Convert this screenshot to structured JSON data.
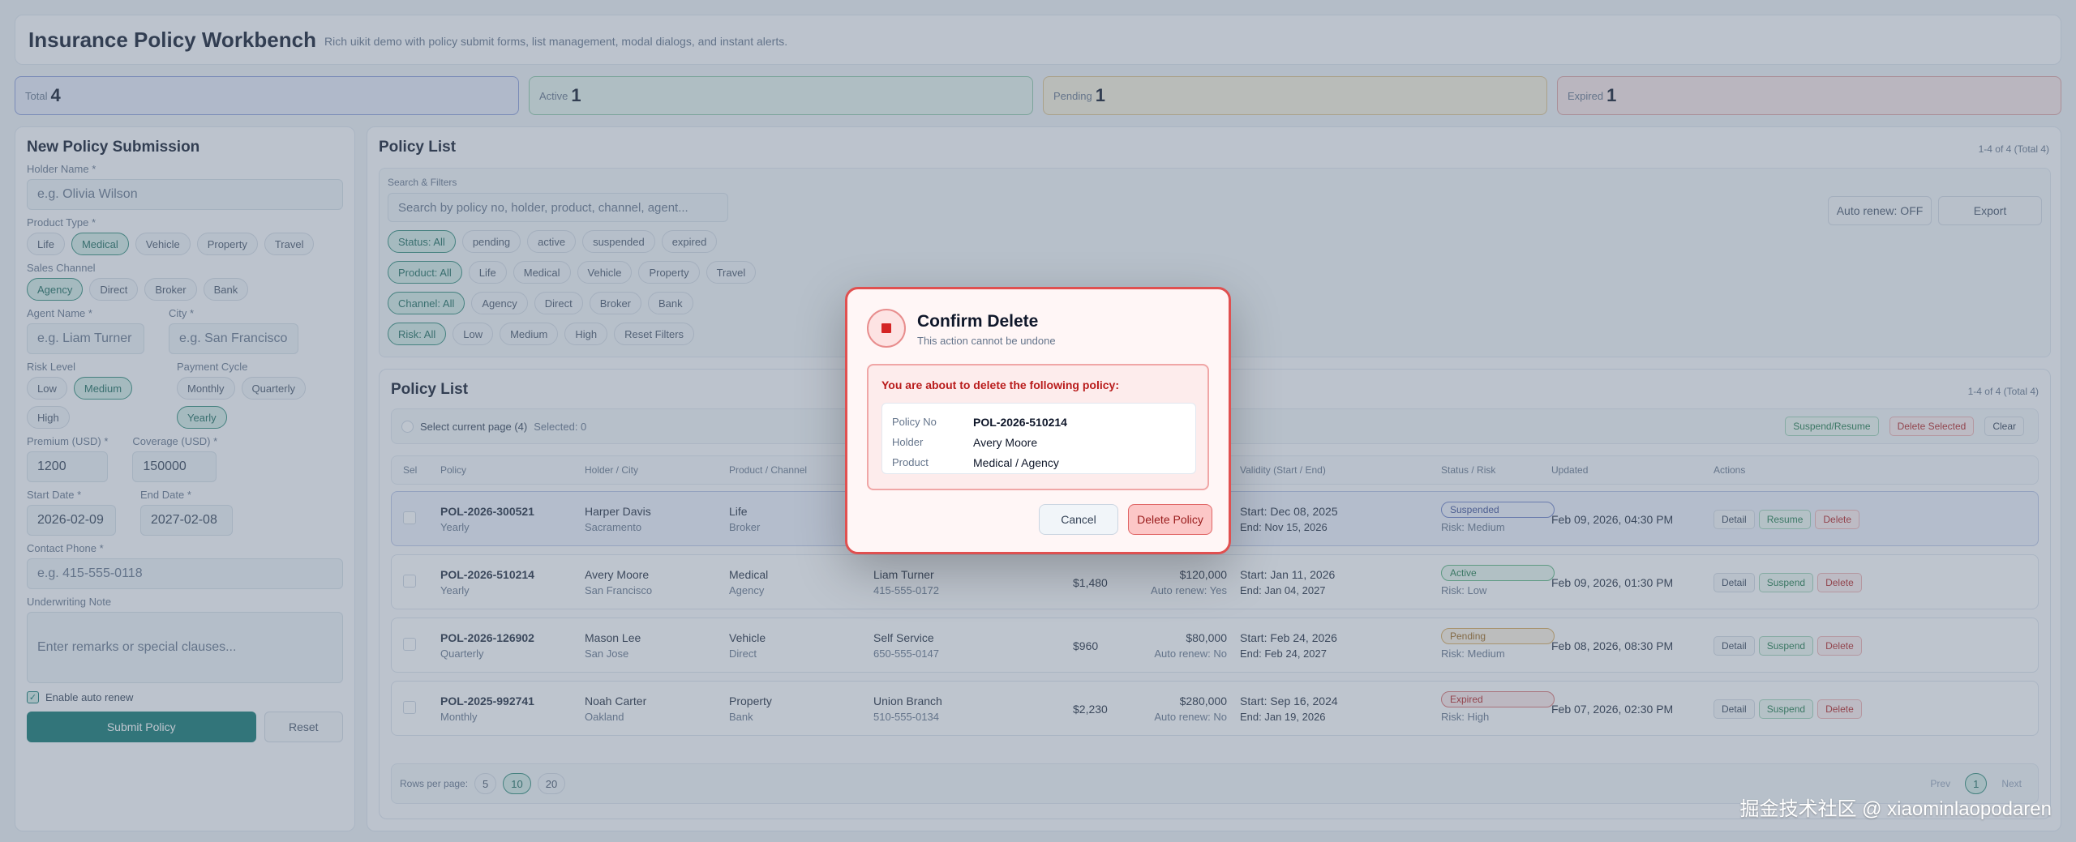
{
  "header": {
    "title": "Insurance Policy Workbench",
    "subtitle": "Rich uikit demo with policy submit forms, list management, modal dialogs, and instant alerts."
  },
  "stats": [
    {
      "label": "Total",
      "value": "4"
    },
    {
      "label": "Active",
      "value": "1"
    },
    {
      "label": "Pending",
      "value": "1"
    },
    {
      "label": "Expired",
      "value": "1"
    }
  ],
  "colors": {
    "total_bg": "#e7ebf8",
    "total_border": "#8a9cd7",
    "active_bg": "#e6f3ec",
    "active_border": "#8cc7a6",
    "pending_bg": "#f7efdb",
    "pending_border": "#dcc18a",
    "expired_bg": "#f8e6e6",
    "expired_border": "#dca0a0",
    "accent": "#0f766e",
    "danger": "#e05050"
  },
  "form": {
    "title": "New Policy Submission",
    "holder_label": "Holder Name *",
    "holder_placeholder": "e.g. Olivia Wilson",
    "product_label": "Product Type *",
    "products": [
      "Life",
      "Medical",
      "Vehicle",
      "Property",
      "Travel"
    ],
    "channel_label": "Sales Channel",
    "channels": [
      "Agency",
      "Direct",
      "Broker",
      "Bank"
    ],
    "agent_label": "Agent Name *",
    "agent_placeholder": "e.g. Liam Turner",
    "city_label": "City *",
    "city_placeholder": "e.g. San Francisco",
    "risk_label": "Risk Level",
    "risks": [
      "Low",
      "Medium",
      "High"
    ],
    "cycle_label": "Payment Cycle",
    "cycles": [
      "Monthly",
      "Quarterly",
      "Yearly"
    ],
    "premium_label": "Premium (USD) *",
    "premium_value": "1200",
    "coverage_label": "Coverage (USD) *",
    "coverage_value": "150000",
    "start_label": "Start Date *",
    "start_value": "2026-02-09",
    "end_label": "End Date *",
    "end_value": "2027-02-08",
    "phone_label": "Contact Phone *",
    "phone_placeholder": "e.g. 415-555-0118",
    "note_label": "Underwriting Note",
    "note_placeholder": "Enter remarks or special clauses...",
    "auto_renew_label": "Enable auto renew",
    "submit_label": "Submit Policy",
    "reset_label": "Reset"
  },
  "list": {
    "title": "Policy List",
    "count": "1-4 of 4 (Total 4)",
    "filters_label": "Search & Filters",
    "search_placeholder": "Search by policy no, holder, product, channel, agent...",
    "auto_renew_btn": "Auto renew: OFF",
    "export_btn": "Export",
    "status_chips": [
      "Status: All",
      "pending",
      "active",
      "suspended",
      "expired"
    ],
    "product_chips": [
      "Product: All",
      "Life",
      "Medical",
      "Vehicle",
      "Property",
      "Travel"
    ],
    "channel_chips": [
      "Channel: All",
      "Agency",
      "Direct",
      "Broker",
      "Bank"
    ],
    "risk_chips": [
      "Risk: All",
      "Low",
      "Medium",
      "High",
      "Reset Filters"
    ],
    "inner_title": "Policy List",
    "inner_count": "1-4 of 4 (Total 4)",
    "select_page": "Select current page (4)",
    "selected": "Selected: 0",
    "bulk_suspend": "Suspend/Resume",
    "bulk_delete": "Delete Selected",
    "clear": "Clear",
    "columns": [
      "Sel",
      "Policy",
      "Holder / City",
      "Product / Channel",
      "Validity (Start / End)",
      "Status / Risk",
      "Updated",
      "Actions"
    ],
    "rows": [
      {
        "policy": "POL-2026-300521",
        "cycle": "Yearly",
        "holder": "Harper Davis",
        "city": "Sacramento",
        "product": "Life",
        "channel": "Broker",
        "agent": "",
        "phone": "",
        "premium": "",
        "coverage": "",
        "renew": "",
        "start": "Start: Dec 08, 2025",
        "end": "End: Nov 15, 2026",
        "status": "Suspended",
        "risk": "Risk: Medium",
        "updated": "Feb 09, 2026, 04:30 PM",
        "toggle": "Resume"
      },
      {
        "policy": "POL-2026-510214",
        "cycle": "Yearly",
        "holder": "Avery Moore",
        "city": "San Francisco",
        "product": "Medical",
        "channel": "Agency",
        "agent": "Liam Turner",
        "phone": "415-555-0172",
        "premium": "$1,480",
        "coverage": "$120,000",
        "renew": "Auto renew: Yes",
        "start": "Start: Jan 11, 2026",
        "end": "End: Jan 04, 2027",
        "status": "Active",
        "risk": "Risk: Low",
        "updated": "Feb 09, 2026, 01:30 PM",
        "toggle": "Suspend"
      },
      {
        "policy": "POL-2026-126902",
        "cycle": "Quarterly",
        "holder": "Mason Lee",
        "city": "San Jose",
        "product": "Vehicle",
        "channel": "Direct",
        "agent": "Self Service",
        "phone": "650-555-0147",
        "premium": "$960",
        "coverage": "$80,000",
        "renew": "Auto renew: No",
        "start": "Start: Feb 24, 2026",
        "end": "End: Feb 24, 2027",
        "status": "Pending",
        "risk": "Risk: Medium",
        "updated": "Feb 08, 2026, 08:30 PM",
        "toggle": "Suspend"
      },
      {
        "policy": "POL-2025-992741",
        "cycle": "Monthly",
        "holder": "Noah Carter",
        "city": "Oakland",
        "product": "Property",
        "channel": "Bank",
        "agent": "Union Branch",
        "phone": "510-555-0134",
        "premium": "$2,230",
        "coverage": "$280,000",
        "renew": "Auto renew: No",
        "start": "Start: Sep 16, 2024",
        "end": "End: Jan 19, 2026",
        "status": "Expired",
        "risk": "Risk: High",
        "updated": "Feb 07, 2026, 02:30 PM",
        "toggle": "Suspend"
      }
    ],
    "detail_btn": "Detail",
    "delete_btn": "Delete",
    "rows_per_page": "Rows per page:",
    "page_sizes": [
      "5",
      "10",
      "20"
    ],
    "prev": "Prev",
    "page": "1",
    "next": "Next"
  },
  "modal": {
    "title": "Confirm Delete",
    "subtitle": "This action cannot be undone",
    "warning": "You are about to delete the following policy:",
    "policy_no_label": "Policy No",
    "policy_no": "POL-2026-510214",
    "holder_label": "Holder",
    "holder": "Avery Moore",
    "product_label": "Product",
    "product": "Medical / Agency",
    "cancel": "Cancel",
    "delete": "Delete Policy"
  },
  "watermark": "掘金技术社区 @ xiaominlaopodaren"
}
